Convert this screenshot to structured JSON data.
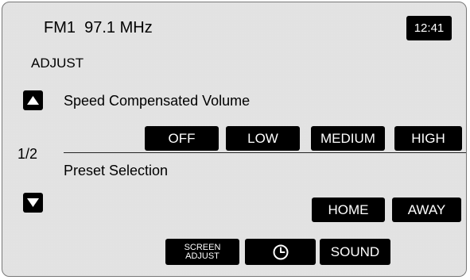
{
  "header": {
    "station": "FM1  97.1 MHz",
    "clock": "12:41"
  },
  "section_title": "ADJUST",
  "page_indicator": "1/2",
  "speed_volume": {
    "label": "Speed Compensated Volume",
    "options": [
      "OFF",
      "LOW",
      "MEDIUM",
      "HIGH"
    ]
  },
  "preset": {
    "label": "Preset Selection",
    "options": [
      "HOME",
      "AWAY"
    ]
  },
  "footer": {
    "screen_adjust_line1": "SCREEN",
    "screen_adjust_line2": "ADJUST",
    "clock_icon": "clock-icon",
    "sound": "SOUND"
  },
  "icons": {
    "up": "up-arrow-icon",
    "down": "down-arrow-icon"
  }
}
